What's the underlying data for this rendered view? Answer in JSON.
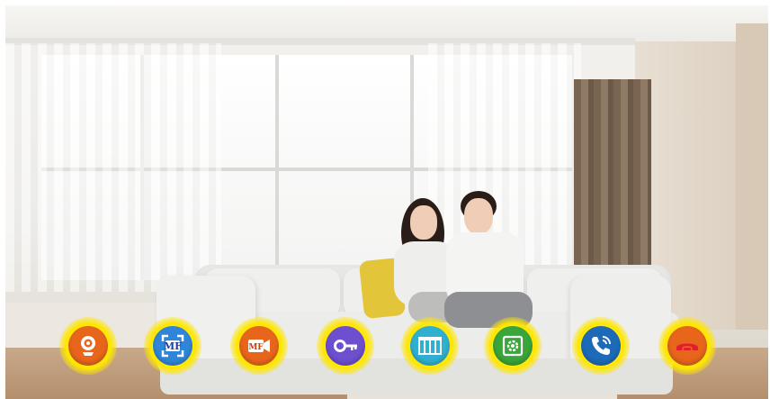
{
  "toolbar": {
    "buttons": [
      {
        "icon": "webcam-icon",
        "color": "#e8651c"
      },
      {
        "icon": "mf-capture-icon",
        "label": "MF",
        "color": "#2f86d8"
      },
      {
        "icon": "mf-video-icon",
        "label": "MF",
        "color": "#e8651c"
      },
      {
        "icon": "key-icon",
        "color": "#6d4fd0"
      },
      {
        "icon": "gate-icon",
        "color": "#2fb0d0"
      },
      {
        "icon": "settings-icon",
        "color": "#3aa53a"
      },
      {
        "icon": "phone-answer-icon",
        "color": "#1d6ab8"
      },
      {
        "icon": "phone-hangup-icon",
        "color": "#e8651c"
      }
    ]
  }
}
